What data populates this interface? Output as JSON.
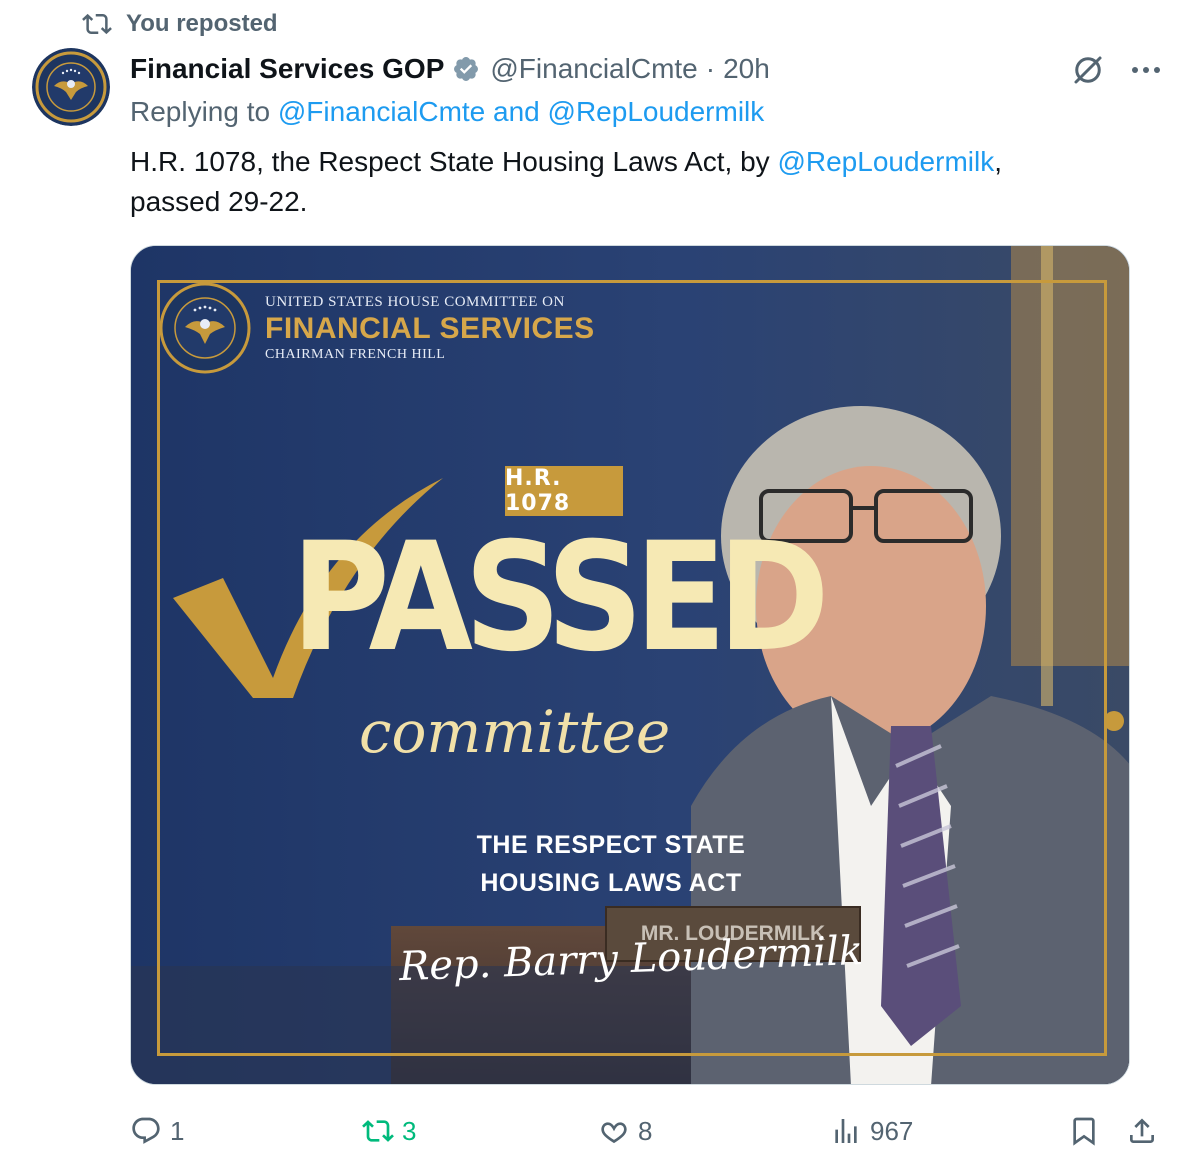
{
  "repost": {
    "label": "You reposted",
    "icon": "repost-icon"
  },
  "author": {
    "display_name": "Financial Services GOP",
    "handle": "@FinancialCmte",
    "separator": "·",
    "time": "20h",
    "verified": true,
    "avatar_icon": "committee-seal-icon"
  },
  "replying": {
    "prefix": "Replying to ",
    "user1": "@FinancialCmte",
    "joiner": " and ",
    "user2": "@RepLoudermilk"
  },
  "tweet": {
    "text_before": "H.R. 1078, the Respect State Housing Laws Act, by ",
    "mention": "@RepLoudermilk",
    "text_after": ",",
    "line2": "passed 29-22."
  },
  "graphic": {
    "committee_line1": "UNITED STATES HOUSE COMMITTEE ON",
    "committee_line2": "FINANCIAL SERVICES",
    "committee_line3": "CHAIRMAN FRENCH HILL",
    "bill_badge": "H.R. 1078",
    "headline": "PASSED",
    "subheadline": "committee",
    "act_line1": "THE RESPECT STATE",
    "act_line2": "HOUSING LAWS ACT",
    "nameplate": "MR. LOUDERMILK",
    "signature": "Rep. Barry Loudermilk",
    "colors": {
      "navy": "#223a6a",
      "gold": "#c79a3c",
      "cream": "#f6e9b4"
    }
  },
  "actions": {
    "replies": "1",
    "reposts": "3",
    "likes": "8",
    "views": "967"
  },
  "colors": {
    "link": "#1d9bf0",
    "muted": "#536471",
    "repost_active": "#00ba7c"
  }
}
